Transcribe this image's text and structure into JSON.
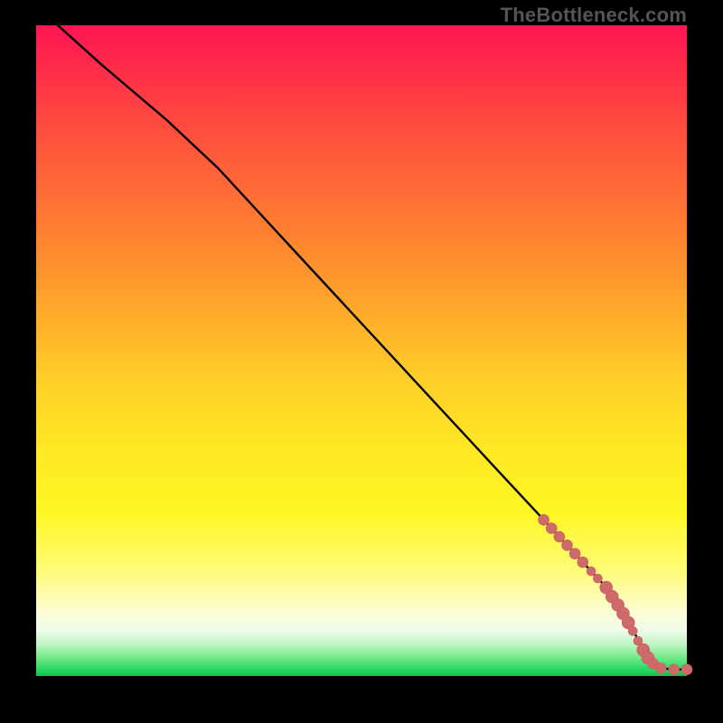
{
  "attribution": "TheBottleneck.com",
  "colors": {
    "line": "#000000",
    "dot": "#cf6a6a",
    "dot_stroke": "#c45f5f"
  },
  "chart_data": {
    "type": "line",
    "title": "",
    "xlabel": "",
    "ylabel": "",
    "xlim": [
      0,
      100
    ],
    "ylim": [
      0,
      100
    ],
    "grid": false,
    "legend": false,
    "series": [
      {
        "name": "curve",
        "x": [
          0,
          10,
          20,
          28,
          40,
          50,
          60,
          70,
          78,
          84,
          88,
          90,
          92,
          94,
          96,
          98,
          100
        ],
        "y": [
          103,
          94,
          85.5,
          78,
          65,
          54.2,
          43.4,
          32.6,
          24,
          17.5,
          13.2,
          10,
          6.5,
          3,
          1.2,
          1.0,
          1.0
        ]
      }
    ],
    "dots": [
      {
        "x": 78.0,
        "y": 24.0,
        "r": 6
      },
      {
        "x": 79.2,
        "y": 22.7,
        "r": 6
      },
      {
        "x": 80.4,
        "y": 21.4,
        "r": 6
      },
      {
        "x": 81.6,
        "y": 20.1,
        "r": 6
      },
      {
        "x": 82.8,
        "y": 18.8,
        "r": 6
      },
      {
        "x": 84.0,
        "y": 17.5,
        "r": 6
      },
      {
        "x": 85.3,
        "y": 16.1,
        "r": 5
      },
      {
        "x": 86.3,
        "y": 15.0,
        "r": 5
      },
      {
        "x": 87.6,
        "y": 13.6,
        "r": 7
      },
      {
        "x": 88.5,
        "y": 12.2,
        "r": 7
      },
      {
        "x": 89.4,
        "y": 10.9,
        "r": 7
      },
      {
        "x": 90.2,
        "y": 9.6,
        "r": 7
      },
      {
        "x": 91.0,
        "y": 8.2,
        "r": 7
      },
      {
        "x": 91.7,
        "y": 6.9,
        "r": 5
      },
      {
        "x": 92.5,
        "y": 5.4,
        "r": 5
      },
      {
        "x": 93.3,
        "y": 4.0,
        "r": 7
      },
      {
        "x": 94.0,
        "y": 2.8,
        "r": 7
      },
      {
        "x": 94.8,
        "y": 1.9,
        "r": 6
      },
      {
        "x": 96.0,
        "y": 1.2,
        "r": 6
      },
      {
        "x": 98.0,
        "y": 1.0,
        "r": 6
      },
      {
        "x": 100.0,
        "y": 1.0,
        "r": 6
      }
    ]
  }
}
